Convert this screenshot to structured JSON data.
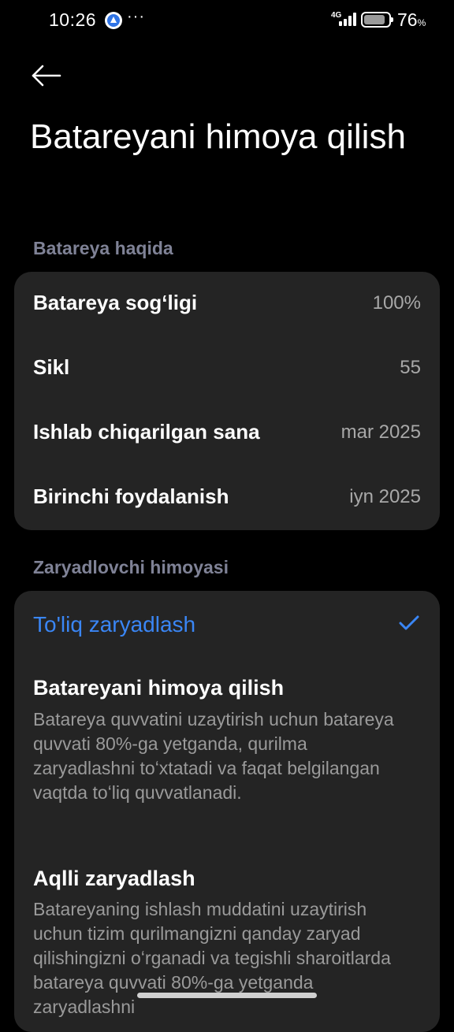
{
  "status_bar": {
    "time": "10:26",
    "more": "···",
    "network": "4G",
    "battery_level": "76",
    "battery_unit": "%",
    "icons": [
      "app-notification-icon",
      "signal-icon",
      "battery-icon"
    ]
  },
  "header": {
    "back_icon": "back-arrow-icon",
    "title": "Batareyani himoya qilish"
  },
  "battery_info": {
    "section_title": "Batareya haqida",
    "rows": [
      {
        "label": "Batareya sog‘ligi",
        "value": "100%"
      },
      {
        "label": "Sikl",
        "value": "55"
      },
      {
        "label": "Ishlab chiqarilgan sana",
        "value": "mar 2025"
      },
      {
        "label": "Birinchi foydalanish",
        "value": "iyn 2025"
      }
    ]
  },
  "charger_protection": {
    "section_title": "Zaryadlovchi himoyasi",
    "options": [
      {
        "title": "To'liq zaryadlash",
        "selected": true,
        "description": ""
      },
      {
        "title": "Batareyani himoya qilish",
        "selected": false,
        "description": "Batareya quvvatini uzaytirish uchun batareya quvvati 80%-ga yetganda, qurilma zaryadlashni toʻxtatadi va faqat belgilangan vaqtda toʻliq quvvatlanadi."
      },
      {
        "title": "Aqlli zaryadlash",
        "selected": false,
        "description": "Batareyaning ishlash muddatini uzaytirish uchun tizim qurilmangizni qanday zaryad qilishingizni oʻrganadi va tegishli sharoitlarda batareya quvvati 80%-ga yetganda zaryadlashni"
      }
    ],
    "check_icon": "checkmark-icon"
  },
  "colors": {
    "background": "#000000",
    "card": "#242424",
    "accent": "#3a86f5",
    "section_header": "#7f8296",
    "secondary_text": "#a8a8a8"
  }
}
